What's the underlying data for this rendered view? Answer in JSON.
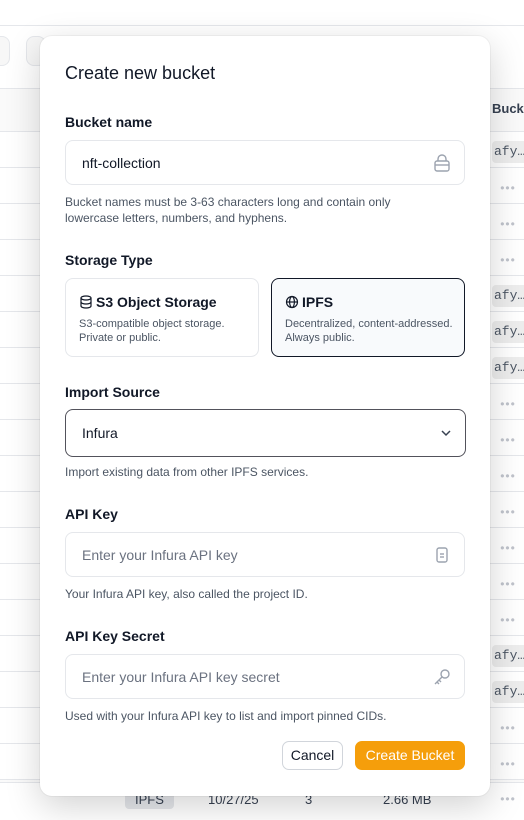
{
  "background": {
    "column_header": "Bucket CID",
    "cid_short": "afy…",
    "dots": "•••",
    "bottom_row": {
      "type": "IPFS",
      "date": "10/27/25",
      "count": "3",
      "size": "2.66 MB"
    }
  },
  "dialog": {
    "title": "Create new bucket",
    "bucket_name": {
      "label": "Bucket name",
      "value": "nft-collection",
      "help": "Bucket names must be 3-63 characters long and contain only lowercase letters, numbers, and hyphens."
    },
    "storage_type": {
      "label": "Storage Type",
      "options": [
        {
          "title": "S3 Object Storage",
          "description": "S3-compatible object storage. Private or public.",
          "icon": "database-icon",
          "selected": false
        },
        {
          "title": "IPFS",
          "description": "Decentralized, content-addressed. Always public.",
          "icon": "globe-icon",
          "selected": true
        }
      ]
    },
    "import_source": {
      "label": "Import Source",
      "value": "Infura",
      "help": "Import existing data from other IPFS services."
    },
    "api_key": {
      "label": "API Key",
      "placeholder": "Enter your Infura API key",
      "help": "Your Infura API key, also called the project ID."
    },
    "api_key_secret": {
      "label": "API Key Secret",
      "placeholder": "Enter your Infura API key secret",
      "help": "Used with your Infura API key to list and import pinned CIDs."
    },
    "buttons": {
      "cancel": "Cancel",
      "create": "Create Bucket"
    }
  },
  "colors": {
    "accent": "#f59e0b",
    "selected_border": "#111827",
    "border": "#e5e7eb"
  }
}
